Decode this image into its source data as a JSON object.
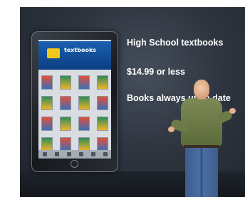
{
  "slide": {
    "bullets": [
      "High School textbooks",
      "$14.99 or less",
      "Books always up to date"
    ]
  },
  "ipad": {
    "banner_title": "textbooks"
  },
  "colors": {
    "slide_background": "#2e3540",
    "banner_blue": "#1b5fb0",
    "shirt_olive": "#6d7a47",
    "jeans_blue": "#4a6ea3"
  }
}
